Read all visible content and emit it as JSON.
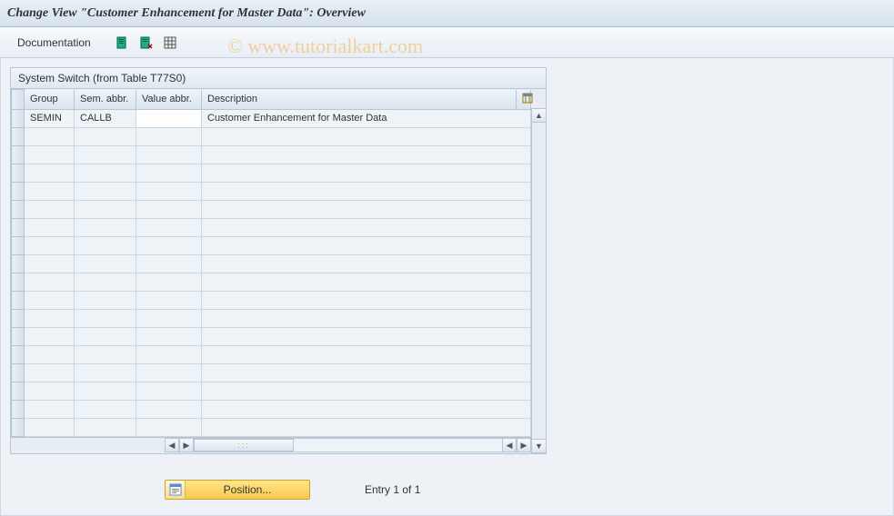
{
  "title": "Change View \"Customer Enhancement for Master Data\": Overview",
  "toolbar": {
    "documentation_label": "Documentation",
    "icon1": "expand-all-icon",
    "icon2": "collapse-all-icon",
    "icon3": "select-columns-icon"
  },
  "watermark": "© www.tutorialkart.com",
  "table": {
    "caption": "System Switch (from Table T77S0)",
    "columns": {
      "group": "Group",
      "sem_abbr": "Sem. abbr.",
      "value_abbr": "Value abbr.",
      "description": "Description"
    },
    "rows": [
      {
        "group": "SEMIN",
        "sem_abbr": "CALLB",
        "value_abbr": "",
        "description": "Customer Enhancement for Master Data"
      }
    ],
    "empty_row_count": 17
  },
  "footer": {
    "position_label": "Position...",
    "entry_text": "Entry 1 of 1"
  }
}
